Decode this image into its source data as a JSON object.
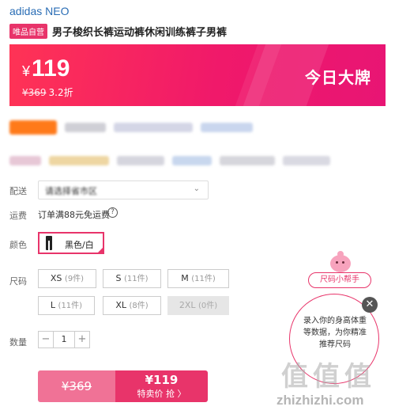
{
  "header": {
    "brand": "adidas NEO",
    "vip_tag": "唯品自营",
    "product_title": "男子梭织长裤运动裤休闲训练裤子男裤"
  },
  "price": {
    "currency": "¥",
    "current": "119",
    "original": "¥369",
    "discount": "3.2折",
    "badge": "今日大牌"
  },
  "delivery": {
    "label": "配送",
    "value": "请选择省市区"
  },
  "freight": {
    "label": "运费",
    "text": "订单满88元免运费",
    "help_icon": "?"
  },
  "color": {
    "label": "颜色",
    "selected": "黑色/白"
  },
  "size": {
    "label": "尺码",
    "options": [
      {
        "size": "XS",
        "stock": "(9件)"
      },
      {
        "size": "S",
        "stock": "(11件)"
      },
      {
        "size": "M",
        "stock": "(11件)"
      },
      {
        "size": "L",
        "stock": "(11件)"
      },
      {
        "size": "XL",
        "stock": "(8件)"
      },
      {
        "size": "2XL",
        "stock": "(0件)"
      }
    ]
  },
  "quantity": {
    "label": "数量",
    "minus": "−",
    "value": "1",
    "plus": "+"
  },
  "buy_bar": {
    "original": "¥369",
    "special_price": "¥119",
    "special_label": "特卖价 抢 〉"
  },
  "size_helper": {
    "tag": "尺码小帮手",
    "bubble_text": "录入你的身高体重等数据，为你精准推荐尺码",
    "close": "✕"
  },
  "watermark": {
    "glyphs": "值值值",
    "text": "zhizhizhi.com"
  },
  "colors": {
    "accent": "#e8346a",
    "banner_start": "#ff3355",
    "banner_end": "#e81574",
    "brand_link": "#2a6db5"
  }
}
